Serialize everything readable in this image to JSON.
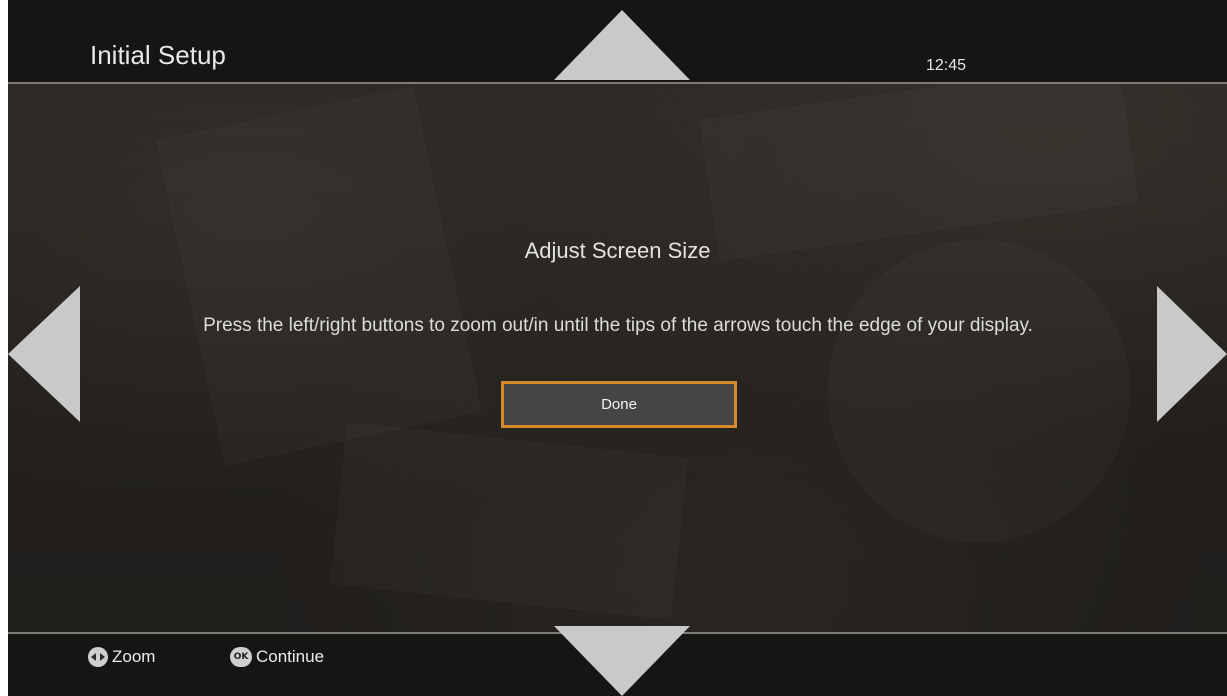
{
  "header": {
    "title": "Initial Setup",
    "clock": "12:45"
  },
  "dialog": {
    "title": "Adjust Screen Size",
    "message": "Press the left/right buttons to zoom out/in until the tips of the arrows touch the edge of your display.",
    "done_label": "Done"
  },
  "footer": {
    "zoom_label": "Zoom",
    "zoom_icon": "left-right-arrows-icon",
    "continue_label": "Continue",
    "ok_icon_text": "OK"
  },
  "colors": {
    "accent": "#d48a2a",
    "arrow": "#c9c9c9",
    "background": "#242220"
  }
}
